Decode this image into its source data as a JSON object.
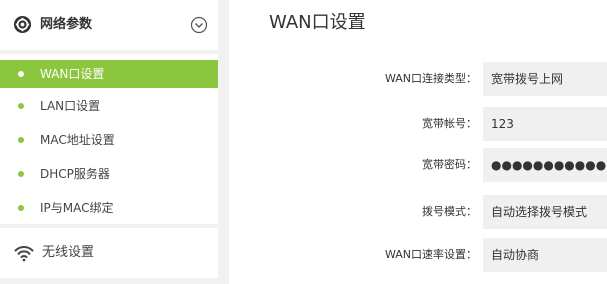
{
  "sidebar": {
    "network_section": {
      "title": "网络参数",
      "icon": "gear-icon",
      "toggle_icon": "chevron-down-circle-icon",
      "items": [
        {
          "label": "WAN口设置",
          "active": true
        },
        {
          "label": "LAN口设置",
          "active": false
        },
        {
          "label": "MAC地址设置",
          "active": false
        },
        {
          "label": "DHCP服务器",
          "active": false
        },
        {
          "label": "IP与MAC绑定",
          "active": false
        }
      ]
    },
    "wireless_section": {
      "title": "无线设置",
      "icon": "wifi-icon"
    }
  },
  "main": {
    "page_title": "WAN口设置",
    "fields": [
      {
        "label": "WAN口连接类型：",
        "value": "宽带拨号上网"
      },
      {
        "label": "宽带帐号：",
        "value": "123"
      },
      {
        "label": "宽带密码：",
        "value": "●●●●●●●●●●●"
      },
      {
        "label": "拨号模式：",
        "value": "自动选择拨号模式"
      },
      {
        "label": "WAN口速率设置：",
        "value": "自动协商"
      }
    ]
  },
  "colors": {
    "accent": "#8cc63f",
    "sidebar_bg": "#f1f1f1",
    "panel_bg": "#ffffff",
    "field_bg": "#f0f0f0"
  }
}
